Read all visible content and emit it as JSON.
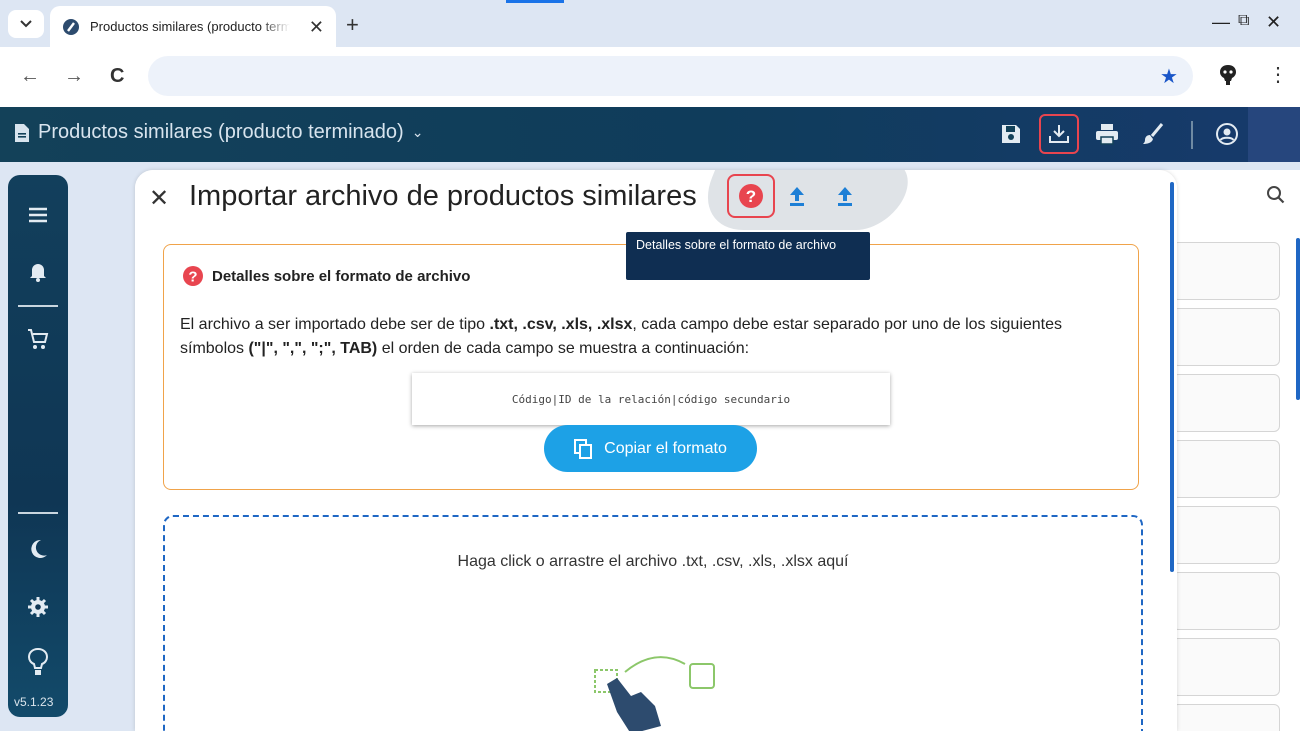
{
  "browser": {
    "tab_title": "Productos similares (producto terminado)",
    "new_tab": "+",
    "tab_close": "✕",
    "minimize": "—",
    "maximize": "⧉",
    "close": "✕",
    "back": "←",
    "forward": "→",
    "reload": "C",
    "bookmark": "★",
    "menu": "⋮"
  },
  "app": {
    "title": "Productos similares (producto terminado)",
    "title_chevron": "⌄",
    "version": "v5.1.23"
  },
  "modal": {
    "close": "✕",
    "title": "Importar archivo de productos similares",
    "format_heading": "Detalles sobre el formato de archivo",
    "desc_prefix": "El archivo a ser importado debe ser de tipo ",
    "desc_types": ".txt, .csv, .xls, .xlsx",
    "desc_mid": ", cada campo debe estar separado por uno de los siguientes símbolos ",
    "desc_symbols": "(\"|\", \",\", \";\", TAB)",
    "desc_suffix": "  el orden de cada campo se muestra a continuación:",
    "format_sample": "Código|ID de la relación|código secundario",
    "copy_button": "Copiar el formato",
    "dropzone_text": "Haga click o arrastre el archivo .txt, .csv, .xls, .xlsx aquí"
  },
  "tooltip": {
    "text": "Detalles sobre el formato de archivo"
  },
  "colors": {
    "header_bg": "#0f3c5b",
    "accent_red": "#e8454f",
    "accent_blue": "#1da1e6",
    "link_blue": "#1f67c4",
    "format_border": "#f0a34a"
  }
}
